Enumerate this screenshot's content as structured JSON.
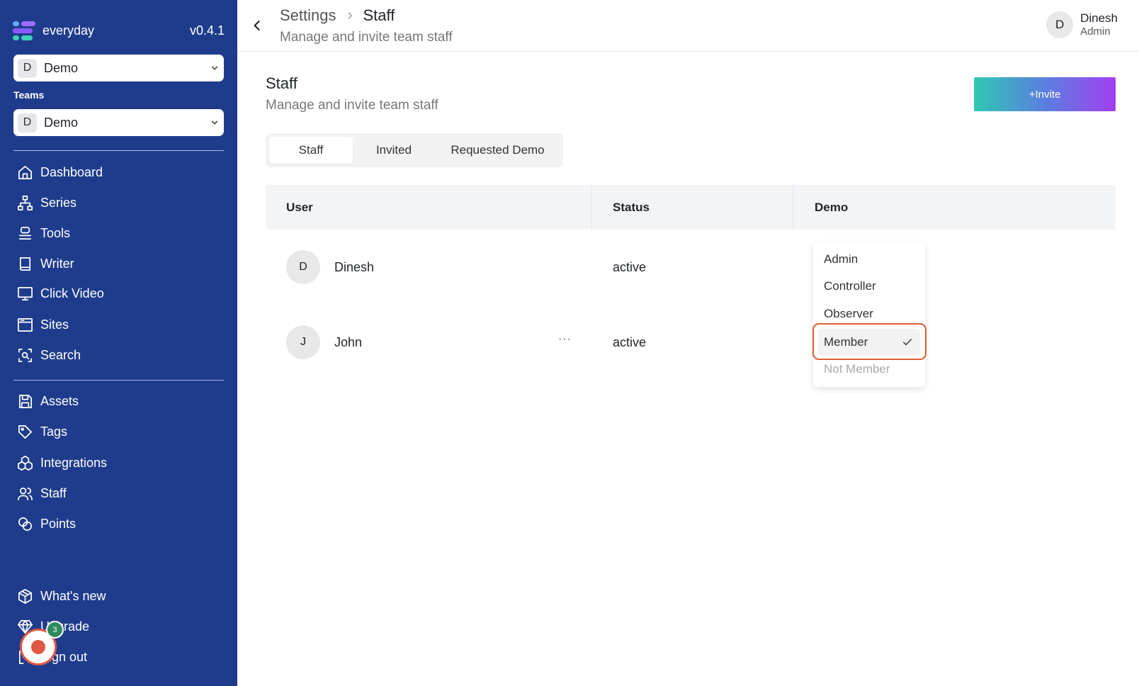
{
  "sidebar": {
    "brand": "everyday",
    "version": "v0.4.1",
    "org_select": {
      "initial": "D",
      "label": "Demo"
    },
    "teams_label": "Teams",
    "team_select": {
      "initial": "D",
      "label": "Demo"
    },
    "nav": [
      {
        "label": "Dashboard",
        "icon": "home-icon"
      },
      {
        "label": "Series",
        "icon": "hierarchy-icon"
      },
      {
        "label": "Tools",
        "icon": "stack-icon"
      },
      {
        "label": "Writer",
        "icon": "book-icon"
      },
      {
        "label": "Click Video",
        "icon": "monitor-icon"
      },
      {
        "label": "Sites",
        "icon": "browser-icon"
      },
      {
        "label": "Search",
        "icon": "scan-search-icon"
      }
    ],
    "nav2": [
      {
        "label": "Assets",
        "icon": "save-icon"
      },
      {
        "label": "Tags",
        "icon": "tag-icon"
      },
      {
        "label": "Integrations",
        "icon": "boxes-icon"
      },
      {
        "label": "Staff",
        "icon": "users-icon"
      },
      {
        "label": "Points",
        "icon": "coins-icon"
      }
    ],
    "bottom": [
      {
        "label": "What's new",
        "icon": "package-icon"
      },
      {
        "label": "Upgrade",
        "icon": "gem-icon"
      },
      {
        "label": "Sign out",
        "icon": "logout-icon"
      }
    ],
    "recorder_badge": "3"
  },
  "header": {
    "crumb_parent": "Settings",
    "crumb_current": "Staff",
    "subtitle": "Manage and invite team staff",
    "user": {
      "initial": "D",
      "name": "Dinesh",
      "role": "Admin"
    }
  },
  "main": {
    "title": "Staff",
    "subtitle": "Manage and invite team staff",
    "invite_label": "+Invite",
    "tabs": [
      "Staff",
      "Invited",
      "Requested Demo"
    ],
    "active_tab": "Staff",
    "columns": [
      "User",
      "Status",
      "Demo"
    ],
    "rows": [
      {
        "initial": "D",
        "name": "Dinesh",
        "status": "active"
      },
      {
        "initial": "J",
        "name": "John",
        "status": "active",
        "more": "···"
      }
    ],
    "role_menu": {
      "options": [
        "Admin",
        "Controller",
        "Observer",
        "Member",
        "Not Member"
      ],
      "selected": "Member",
      "disabled": "Not Member"
    }
  },
  "colors": {
    "sidebar_bg": "#1f3c8c",
    "highlight": "#e05c2e",
    "recorder": "#e05843",
    "badge": "#2f8a5e"
  }
}
